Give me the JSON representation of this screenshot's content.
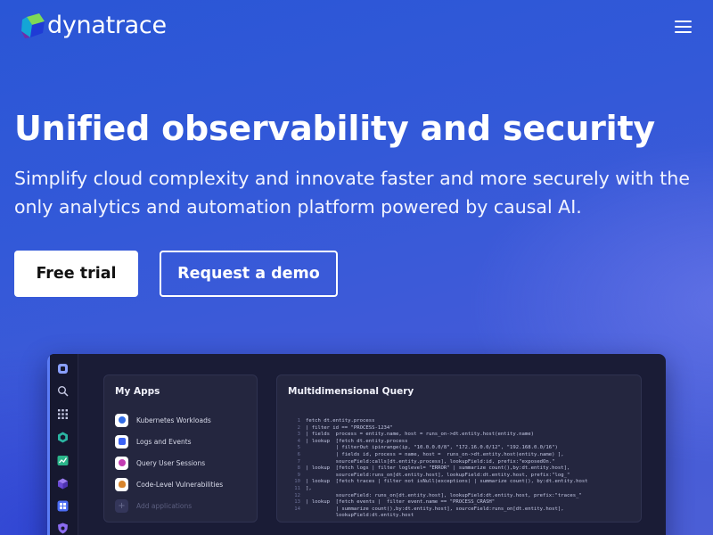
{
  "brand": {
    "name": "dynatrace",
    "colors": {
      "green": "#7ed957",
      "teal": "#14a6d6",
      "blue": "#1f3bd6",
      "purple": "#6f2da8"
    }
  },
  "header": {
    "menu_icon": "hamburger-menu-icon"
  },
  "hero": {
    "title": "Unified observability and security",
    "subtitle": "Simplify cloud complexity and innovate faster and more securely with the only analytics and automation platform powered by causal AI.",
    "primary_button": "Free trial",
    "secondary_button": "Request a demo"
  },
  "product": {
    "rail_icons": [
      "dynatrace-icon",
      "search-icon",
      "apps-grid-icon",
      "hexagon-icon",
      "chart-icon",
      "cube-icon",
      "dashboard-icon",
      "shield-icon"
    ],
    "my_apps": {
      "title": "My Apps",
      "items": [
        {
          "label": "Kubernetes Workloads",
          "icon": "kubernetes-icon",
          "color": "#326ce5"
        },
        {
          "label": "Logs and Events",
          "icon": "logs-icon",
          "color": "#3b62f5"
        },
        {
          "label": "Query User Sessions",
          "icon": "sessions-icon",
          "color": "#c43cb3"
        },
        {
          "label": "Code-Level Vulnerabilities",
          "icon": "bug-icon",
          "color": "#d8842c"
        }
      ],
      "add_label": "Add applications"
    },
    "query": {
      "title": "Multidimensional Query",
      "lines": [
        {
          "n": "1",
          "t": "fetch dt.entity.process"
        },
        {
          "n": "2",
          "t": "| filter id == \"PROCESS-1234\""
        },
        {
          "n": "3",
          "t": "| fields  process = entity.name, host = runs_on->dt.entity.host(entity.name)"
        },
        {
          "n": "4",
          "t": "| lookup  [fetch dt.entity.process"
        },
        {
          "n": "5",
          "t": "          | filterOut ipinrange(ip, \"10.0.0.0/8\", \"172.16.0.0/12\", \"192.168.0.0/16\")"
        },
        {
          "n": "6",
          "t": "          | fields id, process = name, host =  runs_on->dt.entity.host(entity.name) ],"
        },
        {
          "n": "7",
          "t": "          sourceField:calls[dt.entity.process], lookupField:id, prefix:\"exposedOn.\""
        },
        {
          "n": "8",
          "t": "| lookup  [fetch logs | filter loglevel= \"ERROR\" | summarize count(),by:dt.entity.host],"
        },
        {
          "n": "9",
          "t": "          sourceField:runs_on[dt.entity.host], lookupField:dt.entity.host, prefix:\"log_\""
        },
        {
          "n": "10",
          "t": "| lookup  [fetch traces | filter not isNull(exceptions) | summarize count(), by:dt.entity.host"
        },
        {
          "n": "11",
          "t": "],"
        },
        {
          "n": "12",
          "t": "          sourceField: runs_on[dt.entity.host], lookupField:dt.entity.host, prefix:\"traces_\""
        },
        {
          "n": "13",
          "t": "| lookup  [fetch events |  filter event.name == \"PROCESS_CRASH\""
        },
        {
          "n": "14",
          "t": "          | summarize count(),by:dt.entity.host], sourceField:runs_on[dt.entity.host],"
        },
        {
          "n": "",
          "t": "          lookupField:dt.entity.host"
        }
      ]
    }
  }
}
